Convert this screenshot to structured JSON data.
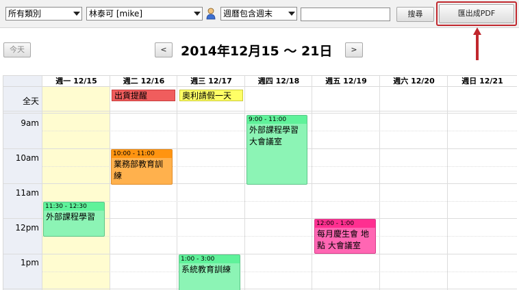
{
  "toolbar": {
    "category_select": "所有類別",
    "user_select": "林泰可 [mike]",
    "week_select": "週曆包含週末",
    "search_value": "",
    "search_button": "搜尋",
    "export_button": "匯出成PDF"
  },
  "nav": {
    "today": "今天",
    "prev": "<",
    "next": ">",
    "title": "2014年12月15 ～ 21日"
  },
  "calendar": {
    "days": [
      "週一 12/15",
      "週二 12/16",
      "週三 12/17",
      "週四 12/18",
      "週五 12/19",
      "週六 12/20",
      "週日 12/21"
    ],
    "allday_label": "全天",
    "times": [
      "9am",
      "10am",
      "11am",
      "12pm",
      "1pm"
    ],
    "allday_events": [
      {
        "title": "出貨提醒",
        "day": "週二 12/16",
        "color": "#f05d5d"
      },
      {
        "title": "奧利請假一天",
        "day": "週三 12/17",
        "color": "#ffff66"
      }
    ],
    "events": [
      {
        "time": "9:00 - 11:00",
        "title": "外部課程學習 大會議室",
        "day": "週四 12/18",
        "color": "#8cf4b5"
      },
      {
        "time": "10:00 - 11:00",
        "title": "業務部教育訓練",
        "day": "週二 12/16",
        "color": "#ffb14d"
      },
      {
        "time": "11:30 - 12:30",
        "title": "外部課程學習",
        "day": "週一 12/15",
        "color": "#8cf4b5"
      },
      {
        "time": "12:00 - 1:00",
        "title": "每月慶生會 地點 大會議室",
        "day": "週五 12/19",
        "color": "#ff66b3"
      },
      {
        "time": "1:00 - 3:00",
        "title": "系統教育訓練",
        "day": "週三 12/17",
        "color": "#8cf4b5"
      }
    ]
  },
  "colors": {
    "highlight": "#c0272d",
    "today_column": "#fffcd0",
    "time_column": "#eceff6"
  }
}
